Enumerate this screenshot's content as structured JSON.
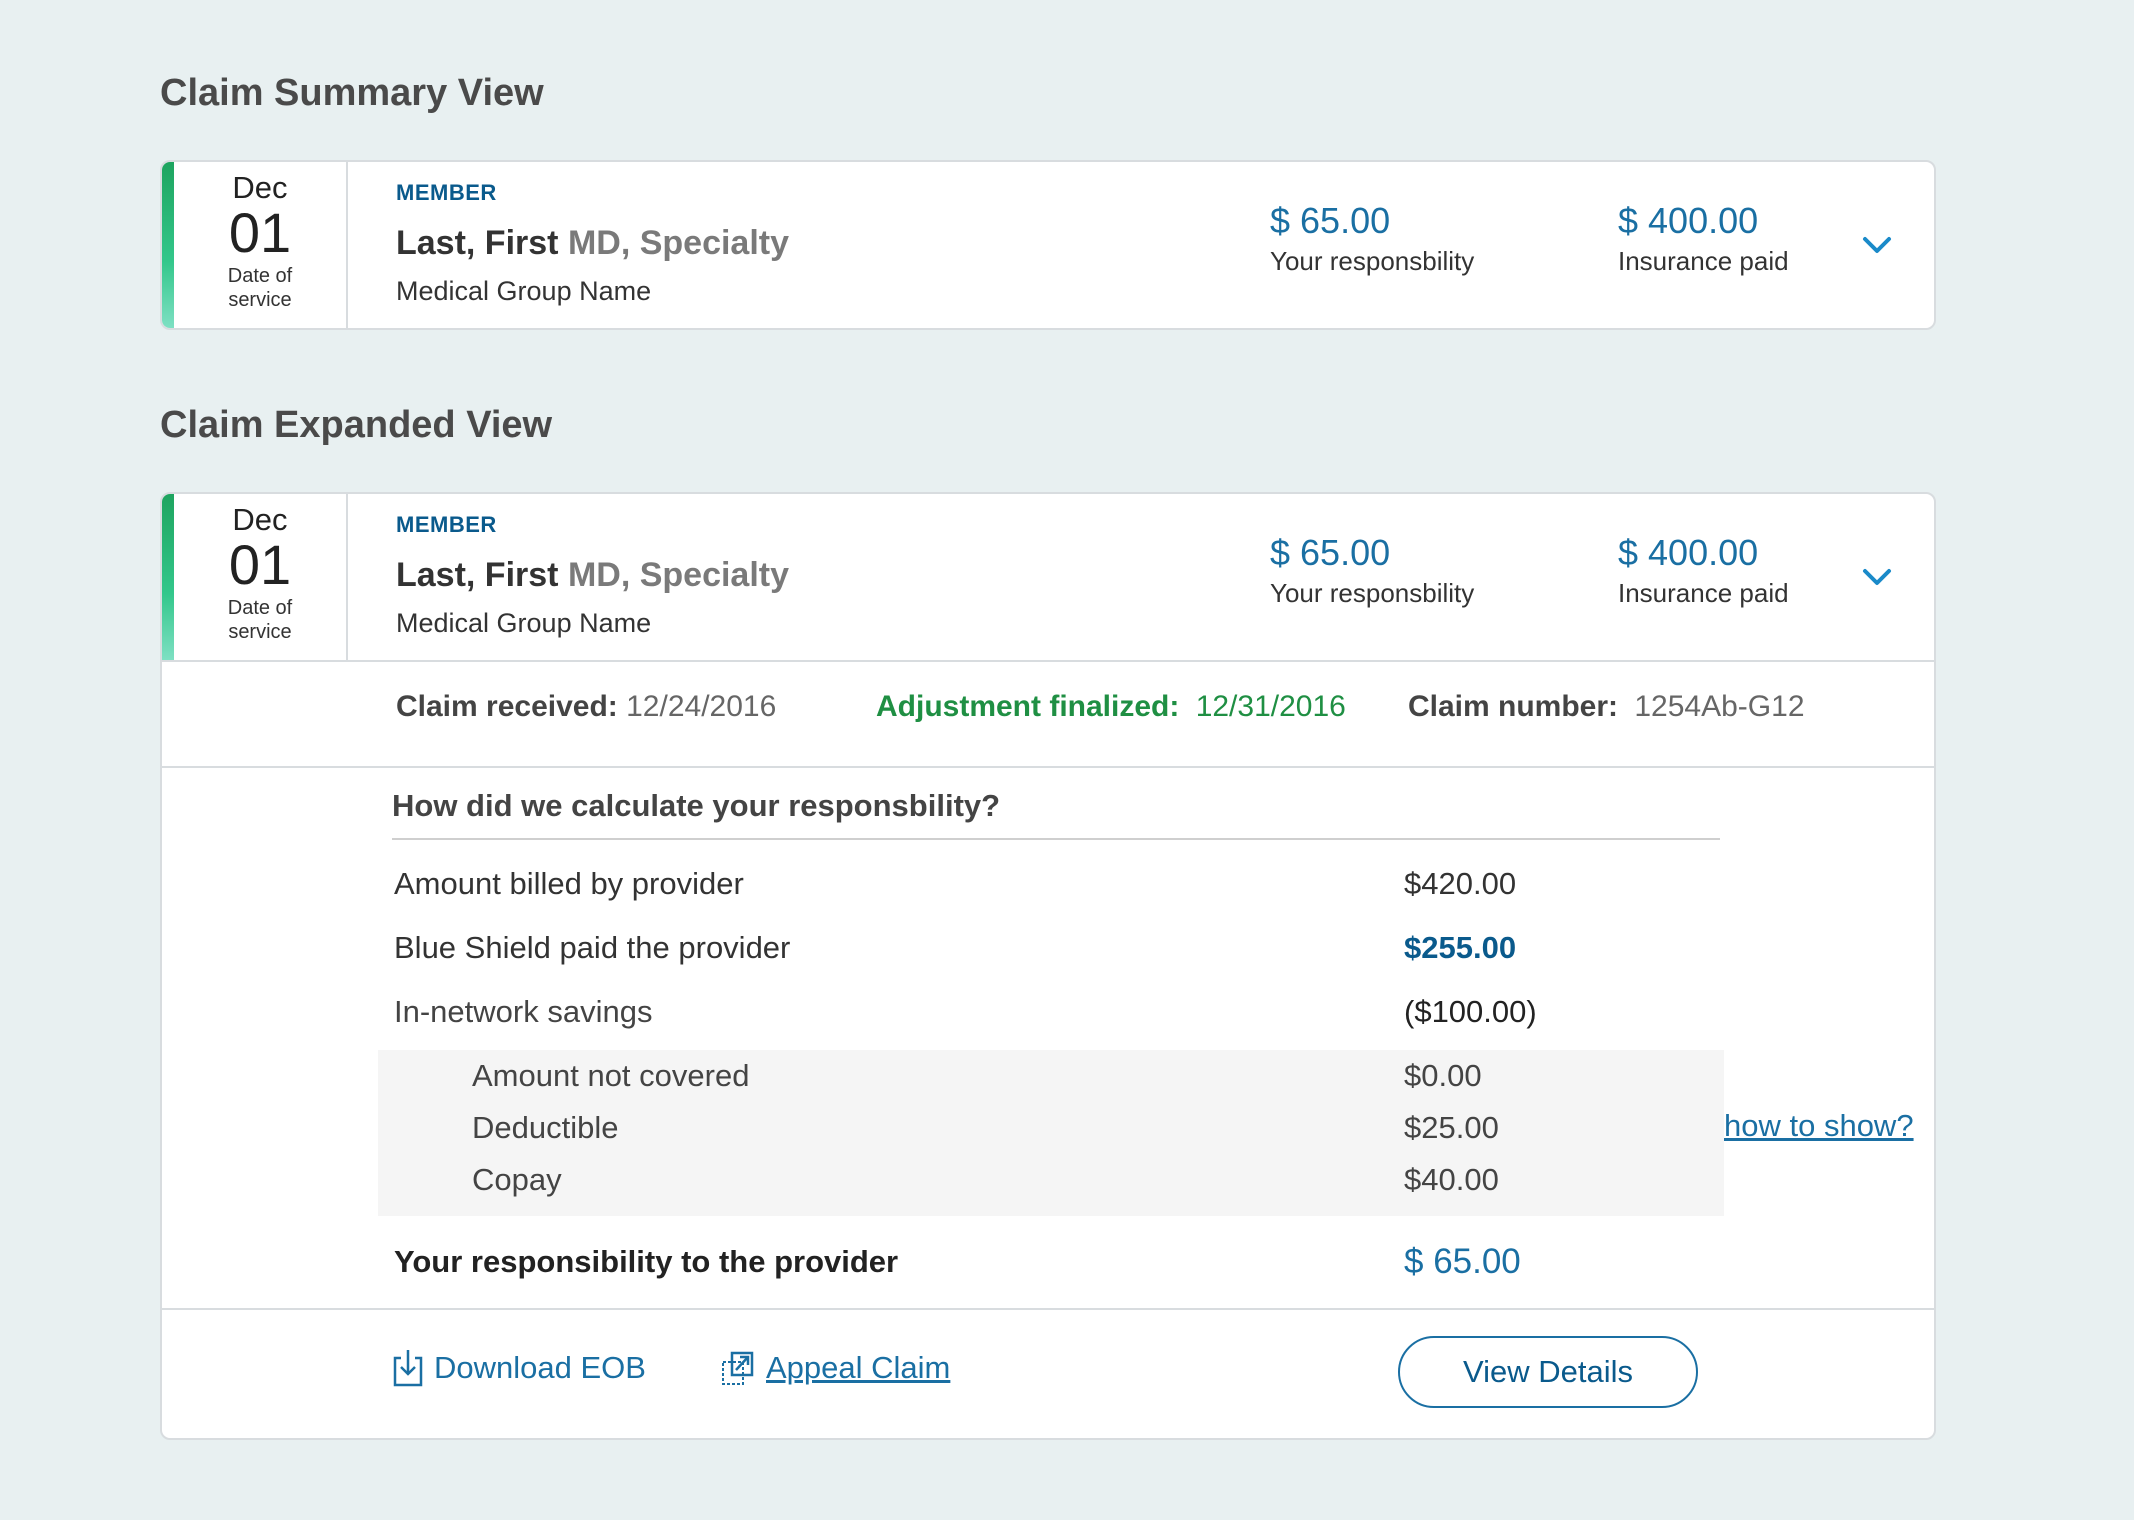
{
  "summary_section": {
    "title": "Claim Summary View"
  },
  "expanded_section": {
    "title": "Claim Expanded View"
  },
  "claim": {
    "date_month": "Dec",
    "date_day": "01",
    "date_caption": "Date of service",
    "member_label": "MEMBER",
    "provider_name": "Last, First",
    "provider_credentials": "MD,",
    "provider_specialty": "Specialty",
    "medical_group": "Medical Group Name",
    "your_responsibility_amount": "$ 65.00",
    "your_responsibility_label": "Your responsbility",
    "insurance_paid_amount": "$ 400.00",
    "insurance_paid_label": "Insurance paid"
  },
  "details": {
    "claim_received_label": "Claim received:",
    "claim_received_value": "12/24/2016",
    "adjustment_label": "Adjustment finalized:",
    "adjustment_value": "12/31/2016",
    "claim_number_label": "Claim number:",
    "claim_number_value": "1254Ab-G12"
  },
  "calculation": {
    "title": "How did we calculate your responsbility?",
    "rows": [
      {
        "label": "Amount billed by provider",
        "value": "$420.00"
      },
      {
        "label": "Blue Shield paid the provider",
        "value": "$255.00"
      },
      {
        "label": "In-network savings",
        "value": "($100.00)"
      }
    ],
    "sub_rows": [
      {
        "label": "Amount not covered",
        "value": "$0.00"
      },
      {
        "label": "Deductible",
        "value": "$25.00"
      },
      {
        "label": "Copay",
        "value": "$40.00"
      }
    ],
    "side_link": "how to show?",
    "total_label": "Your responsibility to the provider",
    "total_value": "$ 65.00"
  },
  "actions": {
    "download_label": "Download EOB",
    "appeal_label": "Appeal Claim",
    "view_details_label": "View Details"
  },
  "colors": {
    "accent_green": "#1ea45f",
    "link_blue": "#1a6fa3",
    "dark_blue": "#0a5a8c",
    "finalized_green": "#1f8f43",
    "background": "#e8f0f1"
  },
  "icons": [
    "chevron-down-icon",
    "download-icon",
    "external-link-icon"
  ]
}
